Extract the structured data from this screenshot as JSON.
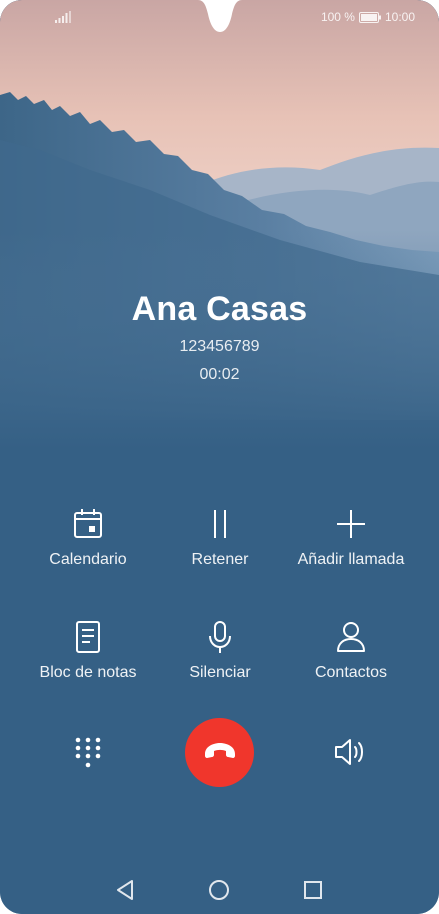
{
  "status_bar": {
    "battery_text": "100 %",
    "time": "10:00"
  },
  "call": {
    "name": "Ana Casas",
    "number": "123456789",
    "duration": "00:02"
  },
  "actions": [
    {
      "label": "Calendario",
      "icon": "calendar-icon"
    },
    {
      "label": "Retener",
      "icon": "pause-icon"
    },
    {
      "label": "Añadir llamada",
      "icon": "plus-icon"
    },
    {
      "label": "Bloc de notas",
      "icon": "notepad-icon"
    },
    {
      "label": "Silenciar",
      "icon": "microphone-icon"
    },
    {
      "label": "Contactos",
      "icon": "person-icon"
    }
  ],
  "bottom_controls": {
    "dialpad_icon": "dialpad-icon",
    "end_call_icon": "phone-hangup-icon",
    "speaker_icon": "speaker-icon",
    "end_call_color": "#f0362c"
  },
  "navigation": {
    "back_icon": "back-triangle-icon",
    "home_icon": "home-circle-icon",
    "recents_icon": "recents-square-icon"
  }
}
